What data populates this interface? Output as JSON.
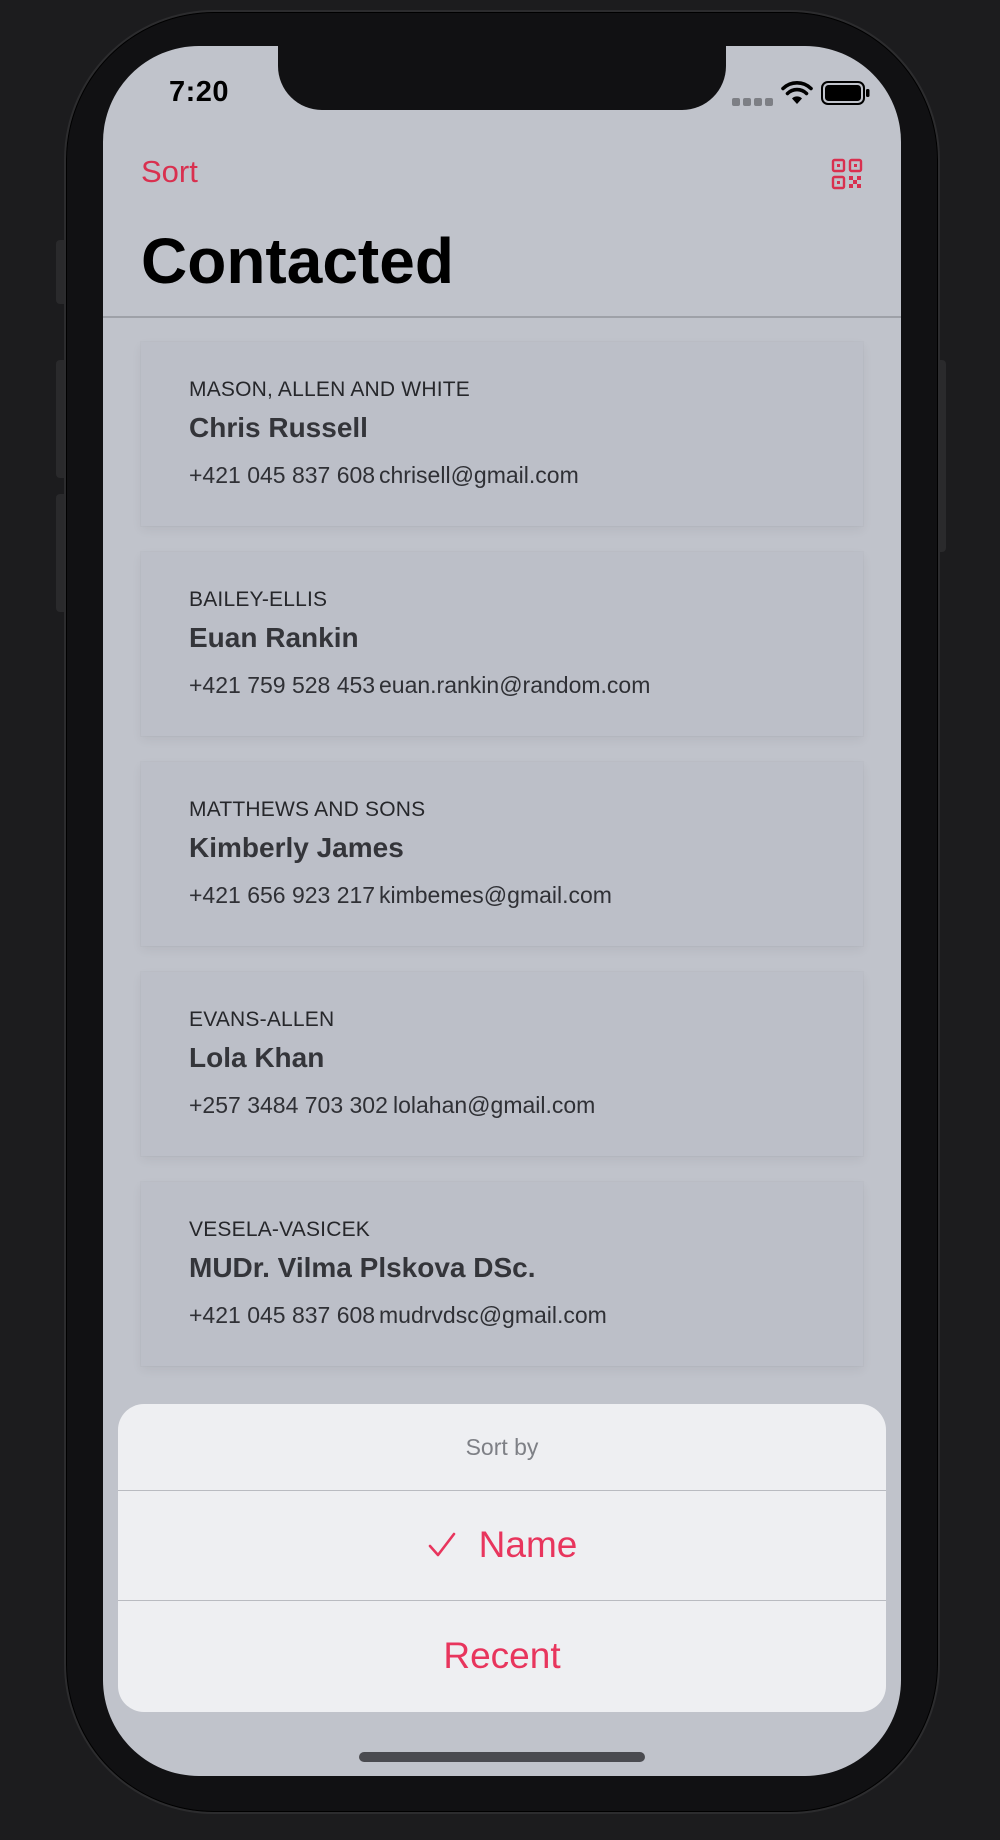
{
  "status_bar": {
    "time": "7:20"
  },
  "nav": {
    "sort_label": "Sort",
    "title": "Contacted"
  },
  "contacts": [
    {
      "company": "MASON, ALLEN AND WHITE",
      "name": "Chris Russell",
      "phone": "+421 045 837 608",
      "email": "chrisell@gmail.com"
    },
    {
      "company": "BAILEY-ELLIS",
      "name": "Euan Rankin",
      "phone": "+421 759 528 453",
      "email": "euan.rankin@random.com"
    },
    {
      "company": "MATTHEWS AND SONS",
      "name": "Kimberly James",
      "phone": "+421 656 923 217",
      "email": "kimbemes@gmail.com"
    },
    {
      "company": "EVANS-ALLEN",
      "name": "Lola Khan",
      "phone": "+257 3484 703 302",
      "email": "lolahan@gmail.com"
    },
    {
      "company": "VESELA-VASICEK",
      "name": "MUDr. Vilma Plskova DSc.",
      "phone": "+421 045 837 608",
      "email": "mudrvdsc@gmail.com"
    }
  ],
  "sort_sheet": {
    "title": "Sort by",
    "options": [
      {
        "label": "Name",
        "selected": true
      },
      {
        "label": "Recent",
        "selected": false
      }
    ]
  },
  "colors": {
    "accent": "#e8355d",
    "screen_bg": "#c0c3cb",
    "sheet_bg": "#eeeff2"
  },
  "icons": {
    "qr": "qr-code-icon",
    "check": "checkmark-icon"
  }
}
